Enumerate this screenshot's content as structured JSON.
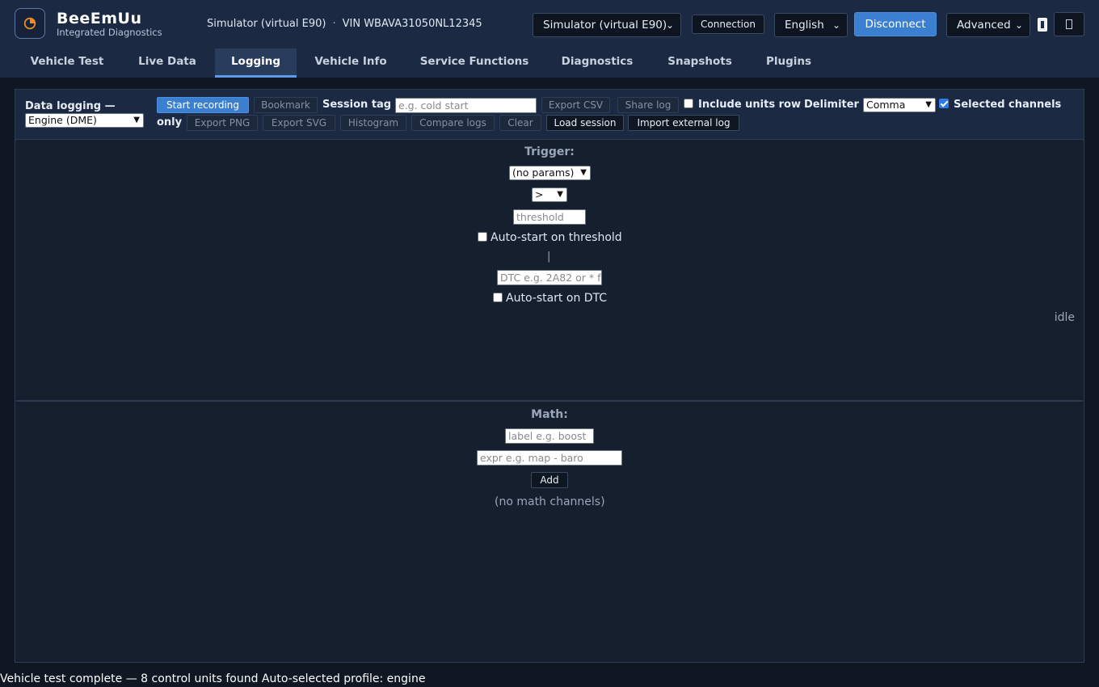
{
  "app": {
    "title": "BeeEmUu",
    "subtitle": "Integrated Diagnostics",
    "logo_icon": "gauge-icon"
  },
  "header": {
    "connection_name": "Simulator (virtual E90)",
    "separator": "·",
    "vin_label": "VIN WBAVA31050NL12345",
    "adapter_select": "Simulator (virtual E90)",
    "connection_button": "Connection",
    "language_select": "English",
    "disconnect_button": "Disconnect",
    "mode_select": "Advanced",
    "icons": [
      "phone-icon",
      "fullscreen-icon"
    ]
  },
  "tabs": [
    {
      "label": "Vehicle Test",
      "active": false
    },
    {
      "label": "Live Data",
      "active": false
    },
    {
      "label": "Logging",
      "active": true
    },
    {
      "label": "Vehicle Info",
      "active": false
    },
    {
      "label": "Service Functions",
      "active": false
    },
    {
      "label": "Diagnostics",
      "active": false
    },
    {
      "label": "Snapshots",
      "active": false
    },
    {
      "label": "Plugins",
      "active": false
    }
  ],
  "toolbar": {
    "data_logging_label": "Data logging —",
    "ecu_select": "Engine (DME)",
    "start_recording": "Start recording",
    "bookmark": "Bookmark",
    "session_tag_label": "Session tag",
    "session_tag_placeholder": "e.g. cold start",
    "export_csv": "Export CSV",
    "share_log": "Share log",
    "include_units_label": "Include units row",
    "include_units_checked": false,
    "delimiter_label": "Delimiter",
    "delimiter_select": "Comma",
    "selected_channels_label": "Selected channels",
    "only_label": "only",
    "selected_channels_checked": true,
    "export_png": "Export PNG",
    "export_svg": "Export SVG",
    "histogram": "Histogram",
    "compare_logs": "Compare logs",
    "clear": "Clear",
    "load_session": "Load session",
    "import_external_log": "Import external log"
  },
  "trigger": {
    "title": "Trigger:",
    "param_select": "(no params)",
    "operator_select": ">",
    "threshold_placeholder": "threshold",
    "auto_threshold_label": "Auto-start on threshold",
    "auto_threshold_checked": false,
    "separator": "|",
    "dtc_placeholder": "DTC e.g. 2A82 or * f",
    "auto_dtc_label": "Auto-start on DTC",
    "auto_dtc_checked": false,
    "status": "idle"
  },
  "math": {
    "title": "Math:",
    "label_placeholder": "label e.g. boost",
    "expr_placeholder": "expr e.g. map - baro",
    "add_button": "Add",
    "empty_text": "(no math channels)"
  },
  "status_bar": {
    "message": "Vehicle test complete — 8 control units found Auto-selected profile: engine"
  },
  "colors": {
    "accent": "#3b7fd1",
    "header_bg": "#1b2942",
    "page_bg": "#0f1722",
    "logo_orange": "#f08a24"
  }
}
